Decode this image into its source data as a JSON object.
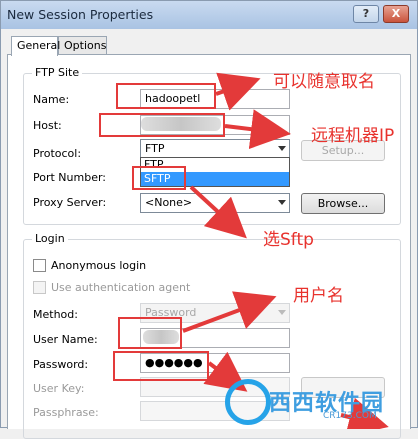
{
  "window": {
    "title": "New Session Properties",
    "help_label": "?",
    "close_label": "X"
  },
  "tabs": [
    "General",
    "Options"
  ],
  "ftp_site": {
    "legend": "FTP Site",
    "name_label": "Name:",
    "name_value": "hadoopetl",
    "host_label": "Host:",
    "protocol_label": "Protocol:",
    "protocol_value": "FTP",
    "protocol_options": [
      "FTP",
      "SFTP"
    ],
    "setup_label": "Setup...",
    "port_label": "Port Number:",
    "proxy_label": "Proxy Server:",
    "proxy_value": "<None>",
    "browse_label": "Browse..."
  },
  "login": {
    "legend": "Login",
    "anonymous_label": "Anonymous login",
    "auth_agent_label": "Use authentication agent",
    "method_label": "Method:",
    "method_value": "Password",
    "username_label": "User Name:",
    "password_label": "Password:",
    "password_value": "●●●●●●",
    "userkey_label": "User Key:",
    "passphrase_label": "Passphrase:"
  },
  "annotations": {
    "name_note": "可以随意取名",
    "host_note": "远程机器IP",
    "protocol_note": "选Sftp",
    "username_note": "用户名"
  },
  "watermark": {
    "text": "西西软件园",
    "url": "CR173.COM"
  },
  "colors": {
    "annotation": "#e8322d",
    "selection": "#3399ff",
    "titlebar": "#b9cfea"
  }
}
